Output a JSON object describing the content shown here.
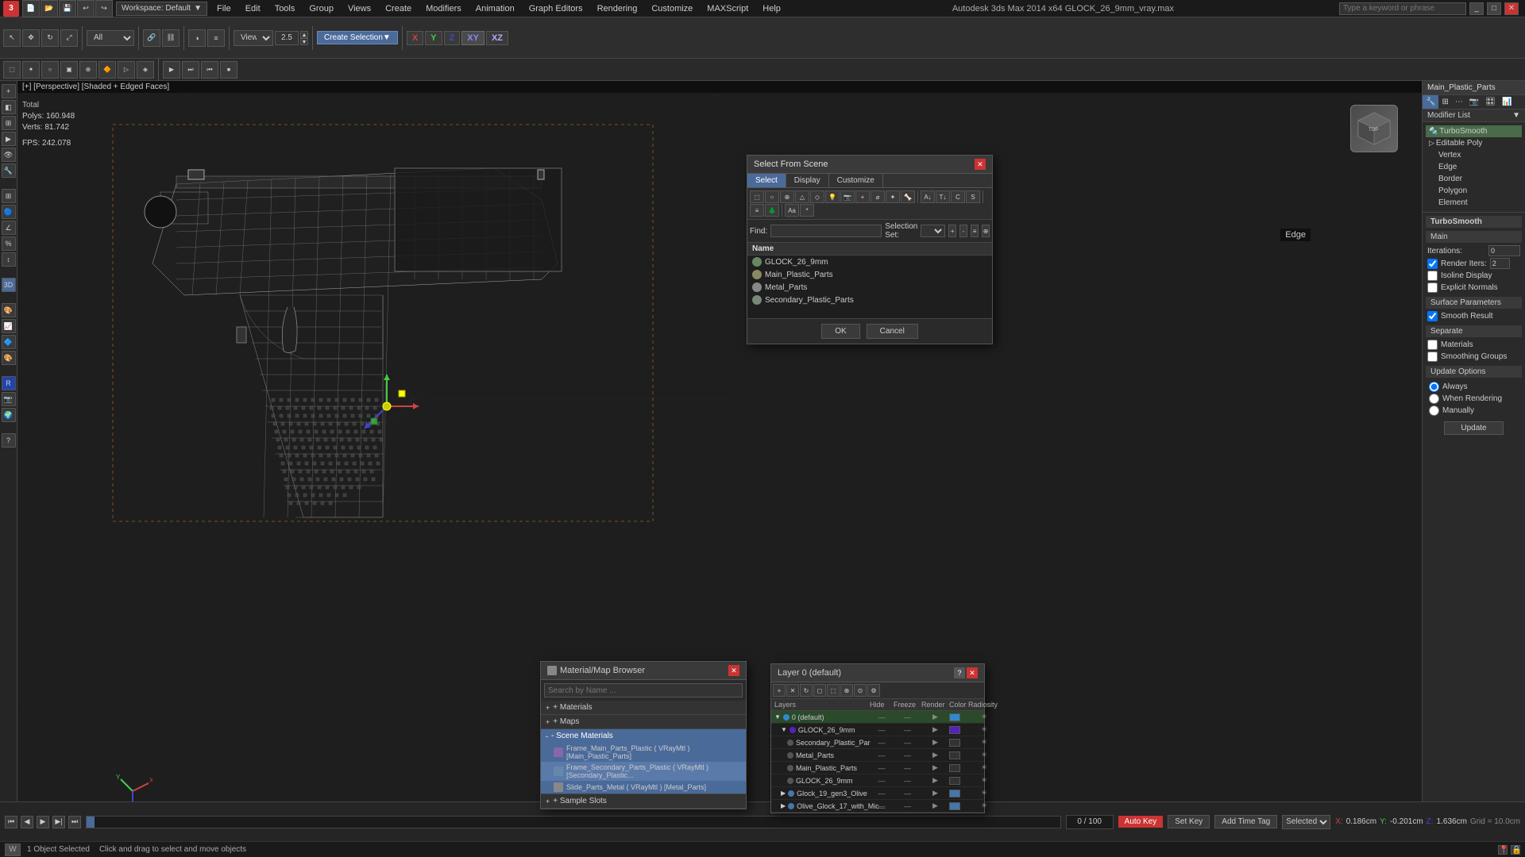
{
  "titleBar": {
    "logo": "3",
    "appTitle": "Autodesk 3ds Max 2014 x64   GLOCK_26_9mm_vray.max",
    "workspace": "Workspace: Default",
    "menus": [
      "File",
      "Edit",
      "Tools",
      "Group",
      "Views",
      "Create",
      "Modifiers",
      "Animation",
      "Graph Editors",
      "Rendering",
      "Customize",
      "MAXScript",
      "Help"
    ],
    "searchPlaceholder": "Type a keyword or phrase",
    "winBtns": [
      "_",
      "□",
      "✕"
    ]
  },
  "viewport": {
    "label": "[+] [Perspective] [Shaded + Edged Faces]",
    "stats": {
      "polysLabel": "Polys:",
      "polysValue": "160.948",
      "vertsLabel": "Verts:",
      "vertsValue": "81.742",
      "fpsLabel": "FPS:",
      "fpsValue": "242.078"
    },
    "edgeLabel": "Edge"
  },
  "selectDialog": {
    "title": "Select From Scene",
    "tabs": [
      "Select",
      "Display",
      "Customize"
    ],
    "findLabel": "Find:",
    "selectionSetLabel": "Selection Set:",
    "nameHeader": "Name",
    "items": [
      {
        "name": "GLOCK_26_9mm",
        "isGroup": true
      },
      {
        "name": "Main_Plastic_Parts"
      },
      {
        "name": "Metal_Parts"
      },
      {
        "name": "Secondary_Plastic_Parts"
      }
    ],
    "okBtn": "OK",
    "cancelBtn": "Cancel"
  },
  "materialBrowser": {
    "title": "Material/Map Browser",
    "searchPlaceholder": "Search by Name ...",
    "sections": [
      {
        "label": "+ Materials",
        "expanded": false
      },
      {
        "label": "+ Maps",
        "expanded": false
      },
      {
        "label": "- Scene Materials",
        "expanded": true
      }
    ],
    "sceneMaterials": [
      {
        "name": "Frame_Main_Parts_Plastic ( VRayMtl ) [Main_Plastic_Parts]"
      },
      {
        "name": "Frame_Secondary_Parts_Plastic ( VRayMtl ) [Secondary_Plastic..."
      },
      {
        "name": "Slide_Parts_Metal ( VRayMtl ) [Metal_Parts]"
      }
    ],
    "sampleSlots": "+ Sample Slots"
  },
  "layerDialog": {
    "title": "Layer 0 (default)",
    "helpBtn": "?",
    "closeBtn": "✕",
    "columns": [
      "Layers",
      "Hide",
      "Freeze",
      "Render",
      "Color",
      "Radiosity"
    ],
    "layers": [
      {
        "name": "0 (default)",
        "level": 0,
        "hide": "",
        "freeze": "",
        "render": "",
        "color": "#3388cc",
        "radiosity": ""
      },
      {
        "name": "GLOCK_26_9mm",
        "level": 1,
        "hide": "",
        "freeze": "",
        "render": "",
        "color": "#5522bb",
        "radiosity": ""
      },
      {
        "name": "Secondary_Plastic_Par",
        "level": 2,
        "hide": "",
        "freeze": "",
        "render": "",
        "color": "#222222",
        "radiosity": ""
      },
      {
        "name": "Metal_Parts",
        "level": 2,
        "hide": "",
        "freeze": "",
        "render": "",
        "color": "#222222",
        "radiosity": ""
      },
      {
        "name": "Main_Plastic_Parts",
        "level": 2,
        "hide": "",
        "freeze": "",
        "render": "",
        "color": "#222222",
        "radiosity": ""
      },
      {
        "name": "GLOCK_26_9mm",
        "level": 2,
        "hide": "",
        "freeze": "",
        "render": "",
        "color": "#222222",
        "radiosity": ""
      },
      {
        "name": "Glock_19_gen3_Olive",
        "level": 1,
        "hide": "",
        "freeze": "",
        "render": "",
        "color": "#4477aa",
        "radiosity": ""
      },
      {
        "name": "Olive_Glock_17_with_Mic...",
        "level": 1,
        "hide": "",
        "freeze": "",
        "render": "",
        "color": "#4477aa",
        "radiosity": ""
      }
    ]
  },
  "rightPanel": {
    "objectName": "Main_Plastic_Parts",
    "modifierListLabel": "Modifier List",
    "modifiers": [
      {
        "name": "TurboSmooth"
      },
      {
        "name": "Editable Poly",
        "expanded": true
      },
      {
        "name": "Vertex",
        "level": 1
      },
      {
        "name": "Edge",
        "level": 1
      },
      {
        "name": "Border",
        "level": 1
      },
      {
        "name": "Polygon",
        "level": 1
      },
      {
        "name": "Element",
        "level": 1
      }
    ],
    "turbosmooth": {
      "title": "TurboSmooth",
      "mainLabel": "Main",
      "iterationsLabel": "Iterations:",
      "iterationsValue": "0",
      "renderItersLabel": "Render Iters:",
      "renderItersValue": "2",
      "isoline": "Isoline Display",
      "explicitNormals": "Explicit Normals",
      "surfaceParams": "Surface Parameters",
      "smoothResult": "Smooth Result",
      "separate": "Separate",
      "materials": "Materials",
      "smoothingGroups": "Smoothing Groups",
      "updateOptions": "Update Options",
      "alwaysLabel": "Always",
      "whenRenderingLabel": "When Rendering",
      "manuallyLabel": "Manually",
      "updateBtn": "Update"
    }
  },
  "bottomBar": {
    "selectedCount": "1 Object Selected",
    "hint": "Click and drag to select and move objects",
    "coords": {
      "x": "0.186cm",
      "y": "-0.201cm",
      "z": "1.636cm"
    },
    "grid": "Grid = 10.0cm",
    "autoKey": "Auto Key",
    "selectedLabel": "Selected",
    "setKey": "Set Key",
    "addTimeTag": "Add Time Tag",
    "timeRange": "0 / 100"
  },
  "icons": {
    "expand": "▶",
    "collapse": "▼",
    "close": "✕",
    "check": "✓",
    "radio": "●",
    "radioEmpty": "○"
  }
}
